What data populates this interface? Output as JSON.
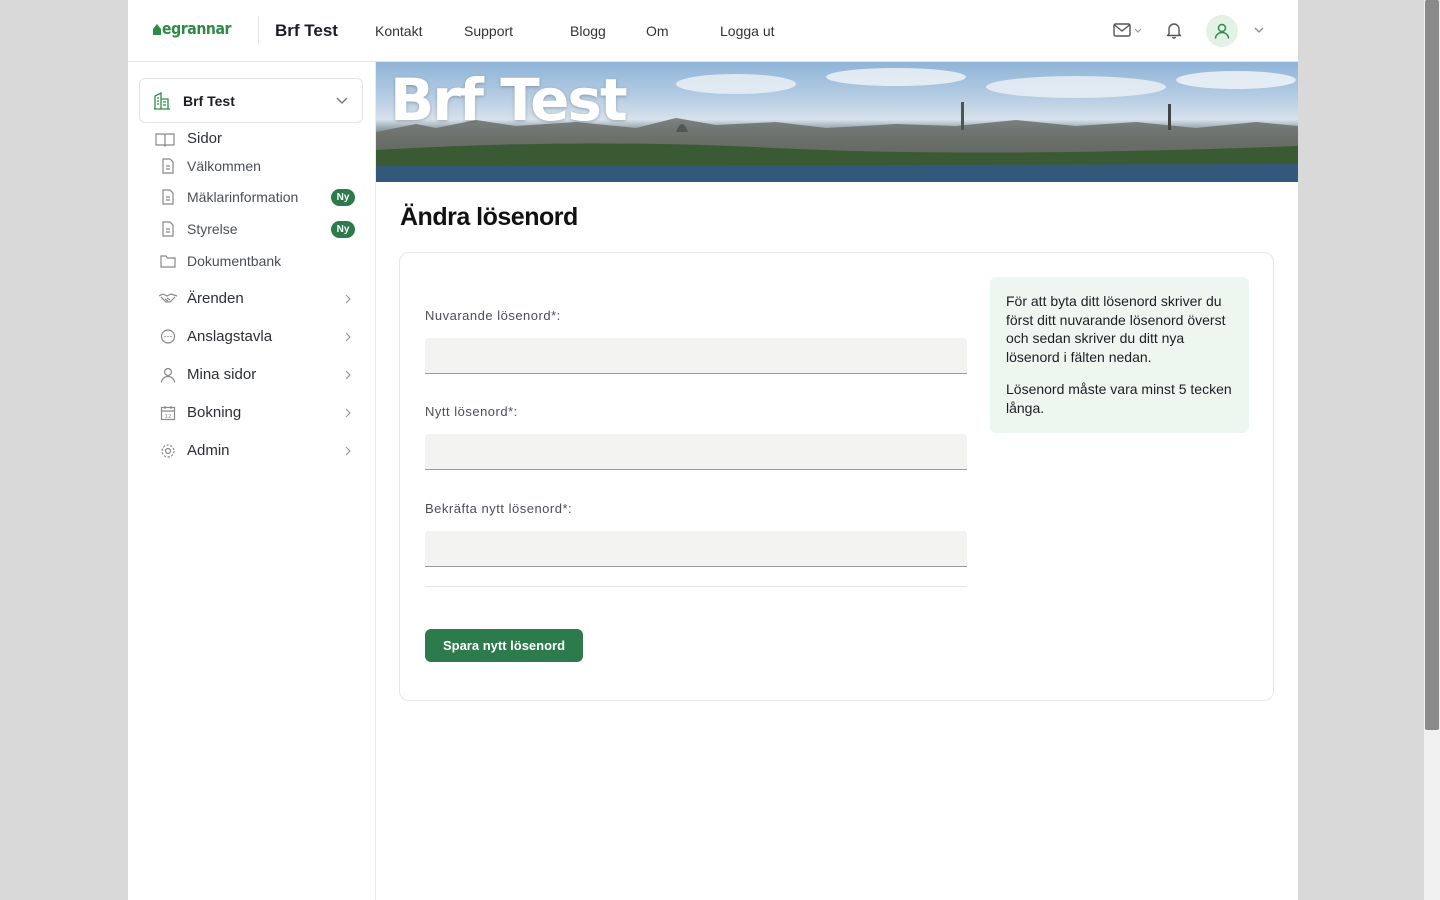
{
  "header": {
    "logo_text": "egrannar",
    "site_name": "Brf Test",
    "nav": [
      "Kontakt",
      "Support",
      "Blogg",
      "Om",
      "Logga ut"
    ]
  },
  "sidebar": {
    "org_name": "Brf Test",
    "section_label": "Sidor",
    "pages": [
      {
        "label": "Välkommen",
        "badge": ""
      },
      {
        "label": "Mäklarinformation",
        "badge": "Ny"
      },
      {
        "label": "Styrelse",
        "badge": "Ny"
      },
      {
        "label": "Dokumentbank",
        "badge": ""
      }
    ],
    "menu": [
      {
        "label": "Ärenden",
        "icon": "handshake-icon"
      },
      {
        "label": "Anslagstavla",
        "icon": "chat-bubble-icon"
      },
      {
        "label": "Mina sidor",
        "icon": "user-icon"
      },
      {
        "label": "Bokning",
        "icon": "calendar-icon"
      },
      {
        "label": "Admin",
        "icon": "gear-icon"
      }
    ]
  },
  "banner": {
    "title": "Brf Test"
  },
  "main": {
    "title": "Ändra lösenord",
    "fields": [
      {
        "label": "Nuvarande lösenord*:",
        "value": ""
      },
      {
        "label": "Nytt lösenord*:",
        "value": ""
      },
      {
        "label": "Bekräfta nytt lösenord*:",
        "value": ""
      }
    ],
    "save_label": "Spara nytt lösenord",
    "info": [
      "För att byta ditt lösenord skriver du först ditt nuvarande lösenord överst och sedan skriver du ditt nya lösenord i fälten nedan.",
      "Lösenord måste vara minst 5 tecken långa."
    ]
  },
  "colors": {
    "accent": "#2d7a4c",
    "info_bg": "#eef6f0",
    "logo": "#2e8b47"
  }
}
